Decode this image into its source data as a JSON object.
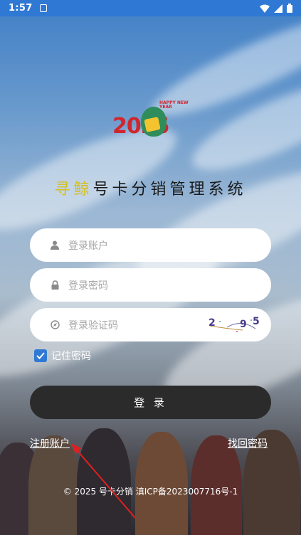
{
  "status_bar": {
    "time": "1:57",
    "icons": [
      "notification-a-icon",
      "wifi-icon",
      "signal-icon",
      "battery-icon"
    ]
  },
  "logo": {
    "year": "2025",
    "tagline": "HAPPY NEW YEAR"
  },
  "title": {
    "accent": "寻鲸",
    "rest": "号卡分销管理系统"
  },
  "form": {
    "account_placeholder": "登录账户",
    "password_placeholder": "登录密码",
    "captcha_placeholder": "登录验证码",
    "captcha_chars": [
      "2",
      "9",
      "5"
    ],
    "remember_label": "记住密码",
    "remember_checked": true,
    "login_label": "登 录"
  },
  "links": {
    "register": "注册账户",
    "forgot": "找回密码"
  },
  "footer": {
    "text": "© 2025 号卡分销  滇ICP备2023007716号-1"
  },
  "colors": {
    "status_bar": "#2f79d4",
    "title_accent": "#d4c021",
    "login_button": "#2b2b2b",
    "checkbox": "#2f79d4",
    "annotation_arrow": "#e02020"
  }
}
